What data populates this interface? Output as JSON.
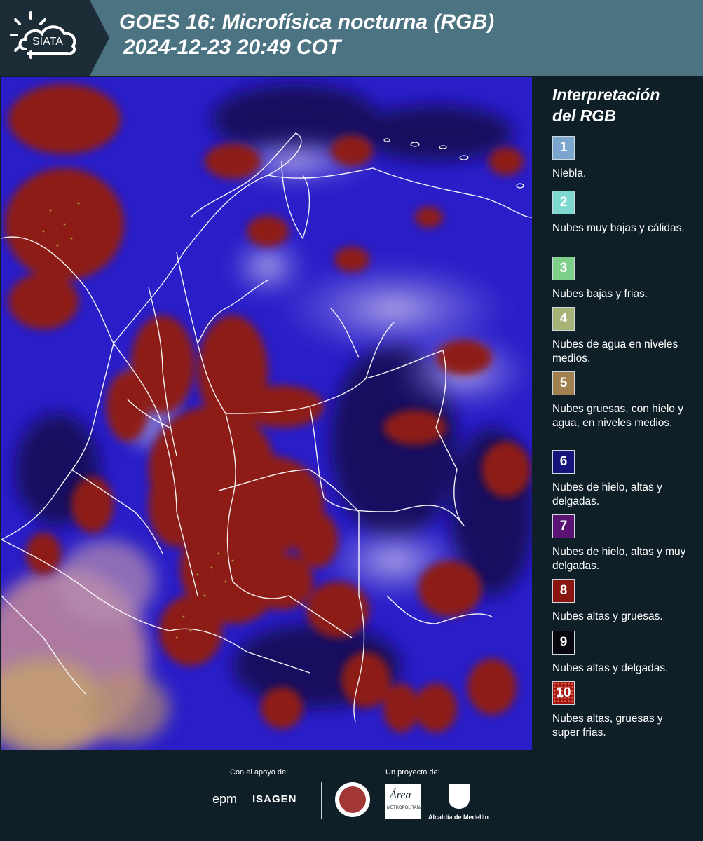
{
  "header": {
    "logo_text": "SIATA",
    "title_line1": "GOES 16: Microfísica nocturna (RGB)",
    "title_line2": "2024-12-23 20:49 COT"
  },
  "legend": {
    "title_line1": "Interpretación",
    "title_line2": "del RGB",
    "items": [
      {
        "number": "1",
        "color": "#7aa6cf",
        "text": "Niebla."
      },
      {
        "number": "2",
        "color": "#7fd8cf",
        "text": "Nubes muy bajas y cálidas."
      },
      {
        "number": "3",
        "color": "#7dcf8a",
        "text": "Nubes bajas y frias."
      },
      {
        "number": "4",
        "color": "#a7b276",
        "text": "Nubes de agua en niveles medios."
      },
      {
        "number": "5",
        "color": "#a0804f",
        "text": "Nubes gruesas, con hielo y agua, en niveles medios."
      },
      {
        "number": "6",
        "color": "#15147a",
        "text": "Nubes de hielo, altas y delgadas."
      },
      {
        "number": "7",
        "color": "#5a1273",
        "text": "Nubes de hielo, altas y muy delgadas."
      },
      {
        "number": "8",
        "color": "#8a1410",
        "text": "Nubes altas y gruesas."
      },
      {
        "number": "9",
        "color": "#07070d",
        "text": "Nubes altas y delgadas."
      },
      {
        "number": "10",
        "color": "#a3160f",
        "text": "Nubes altas, gruesas y super frias."
      }
    ]
  },
  "footer": {
    "support_label": "Con el apoyo de:",
    "project_label": "Un proyecto de:",
    "support_brands": [
      "epm",
      "ISAGEN"
    ],
    "amva_text": "Área",
    "amva_subtext": "METROPOLITANA",
    "medellin_text": "Alcaldía de Medellín"
  },
  "colors": {
    "header_bg": "#4b7382",
    "logo_bg": "#1c2d37",
    "page_bg": "#0e1f28",
    "map_blue": "#2b1fd6",
    "map_red": "#8e1b12",
    "map_lavender": "#9a8ee0"
  }
}
